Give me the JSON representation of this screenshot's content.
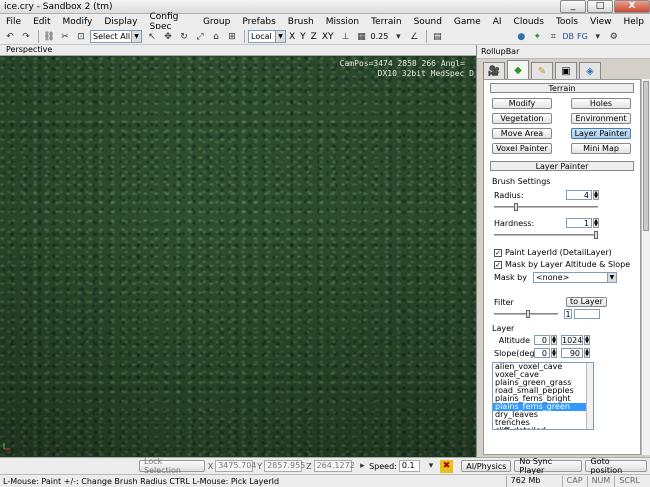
{
  "window": {
    "title": "ice.cry - Sandbox 2 (tm)",
    "controls": [
      "_",
      "□",
      "X"
    ]
  },
  "menu": [
    "File",
    "Edit",
    "Modify",
    "Display",
    "Config Spec",
    "Group",
    "Prefabs",
    "Brush",
    "Mission",
    "Terrain",
    "Sound",
    "Game",
    "AI",
    "Clouds",
    "Tools",
    "View",
    "Help"
  ],
  "toolbar": {
    "selection_filter": "Select All",
    "coord_system": "Local",
    "axes": [
      "X",
      "Y",
      "Z",
      "XY"
    ],
    "grid_size": "0.25",
    "right_labels": [
      "DB",
      "FG"
    ]
  },
  "viewport": {
    "label": "Perspective",
    "campos_line1": "CamPos=3474 2858 266 Angl=",
    "campos_line2": "DX10 32bit MedSpec D"
  },
  "rollup": {
    "title": "RollupBar",
    "terrain_section": "Terrain",
    "buttons": [
      "Modify",
      "Holes",
      "Vegetation",
      "Environment",
      "Move Area",
      "Layer Painter",
      "Voxel Painter",
      "Mini Map"
    ],
    "active_button": "Layer Painter",
    "layer_painter_section": "Layer Painter",
    "brush_settings": "Brush Settings",
    "radius_label": "Radius:",
    "radius_value": "4",
    "hardness_label": "Hardness:",
    "hardness_value": "1",
    "radius_fraction": 0.2,
    "hardness_fraction": 1.0,
    "paint_layer_label": "Paint LayerId (DetailLayer)",
    "mask_altitude_label": "Mask by Layer Altitude & Slope",
    "mask_by_label": "Mask by",
    "mask_by_value": "<none>",
    "filter_label": "Filter",
    "to_layer_button": "to Layer",
    "filter_value": "1",
    "layer_label": "Layer",
    "altitude_label": "Altitude",
    "altitude_min": "0",
    "altitude_max": "1024",
    "slope_label": "Slope(deg.)",
    "slope_min": "0",
    "slope_max": "90",
    "layers": [
      "alien_voxel_cave",
      "voxel_cave",
      "plains_green_grass",
      "road_small_pepples",
      "plains_ferns_bright",
      "plains_ferns_green",
      "dry_leaves",
      "trenches",
      "cliff_detailed"
    ],
    "selected_layer": "plains_ferns_green"
  },
  "bottom_bar": {
    "lock_selection": "Lock Selection",
    "x_label": "X",
    "x_value": "3475.704",
    "y_label": "Y",
    "y_value": "2857.955",
    "z_label": "Z",
    "z_value": "264.1272",
    "speed_label": "Speed:",
    "speed_value": "0.1",
    "ai_physics": "AI/Physics",
    "no_sync_player": "No Sync Player",
    "goto_position": "Goto position"
  },
  "status_bar": {
    "hint": "L-Mouse: Paint  +/-: Change Brush Radius   CTRL L-Mouse: Pick LayerId",
    "memory": "762 Mb",
    "caps": "CAP",
    "num": "NUM",
    "scroll": "SCRL"
  }
}
